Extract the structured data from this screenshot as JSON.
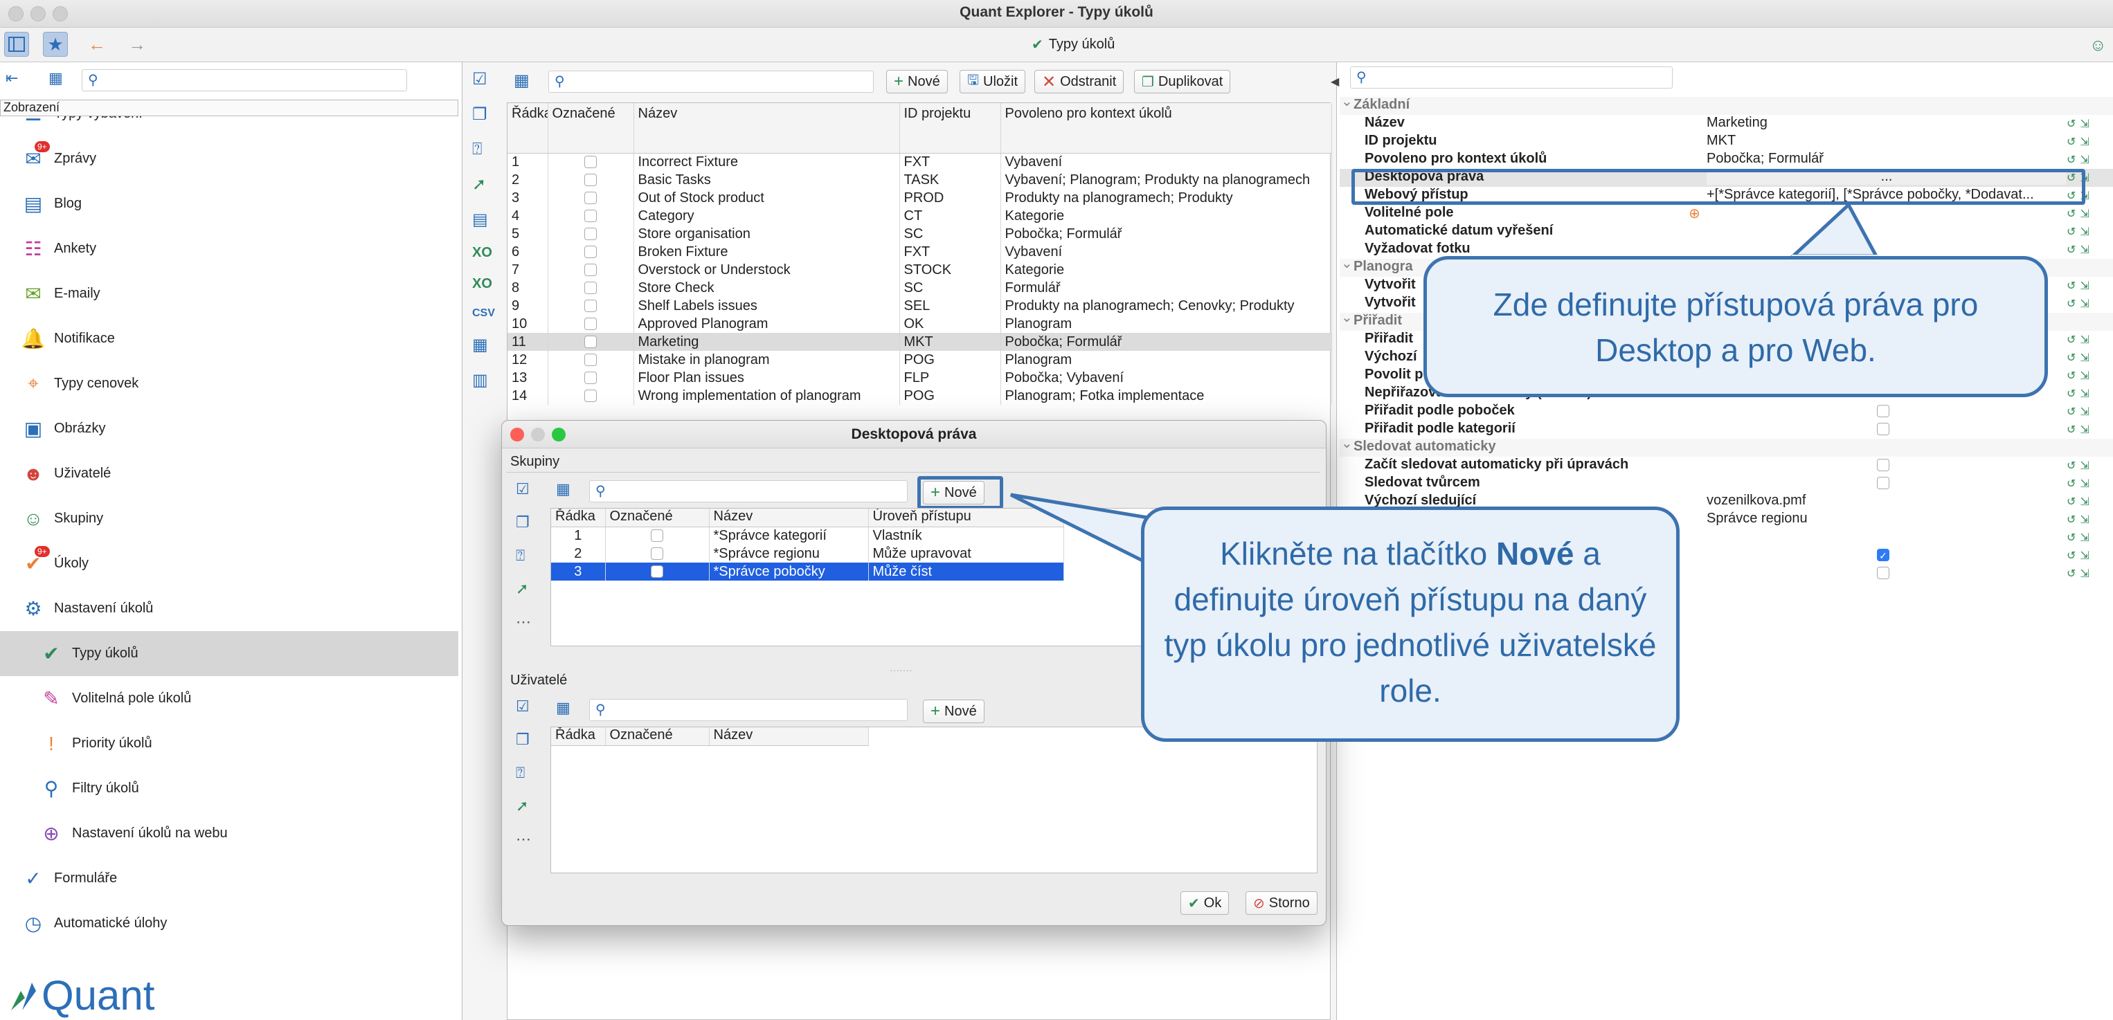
{
  "window": {
    "title": "Quant Explorer - Typy úkolů",
    "center_title": "Typy úkolů"
  },
  "left": {
    "section_label": "Zobrazení",
    "items": [
      {
        "label": "Typy vybavení",
        "icon": "list-icon",
        "color": "#2c6fb7"
      },
      {
        "label": "Zprávy",
        "icon": "messages-icon",
        "badge": "9+",
        "color": "#2c6fb7"
      },
      {
        "label": "Blog",
        "icon": "blog-icon",
        "color": "#2c6fb7"
      },
      {
        "label": "Ankety",
        "icon": "survey-icon",
        "color": "#c23c9b"
      },
      {
        "label": "E-maily",
        "icon": "mail-icon",
        "color": "#6aa32a"
      },
      {
        "label": "Notifikace",
        "icon": "bell-icon",
        "color": "#2c6fb7"
      },
      {
        "label": "Typy cenovek",
        "icon": "price-tag-icon",
        "color": "#e9833a"
      },
      {
        "label": "Obrázky",
        "icon": "image-icon",
        "color": "#2c6fb7"
      },
      {
        "label": "Uživatelé",
        "icon": "user-icon",
        "color": "#d2453c"
      },
      {
        "label": "Skupiny",
        "icon": "group-icon",
        "color": "#2e8b57"
      },
      {
        "label": "Úkoly",
        "icon": "task-icon",
        "badge": "9+",
        "color": "#e9833a"
      },
      {
        "label": "Nastavení úkolů",
        "icon": "task-settings-icon",
        "color": "#2c6fb7"
      },
      {
        "label": "Typy úkolů",
        "icon": "task-type-icon",
        "color": "#2e8b57",
        "selected": true,
        "indent": true
      },
      {
        "label": "Volitelná pole úkolů",
        "icon": "optional-fields-icon",
        "color": "#c23c9b",
        "indent": true
      },
      {
        "label": "Priority úkolů",
        "icon": "priority-icon",
        "color": "#e9833a",
        "indent": true
      },
      {
        "label": "Filtry úkolů",
        "icon": "filter-icon",
        "color": "#2c6fb7",
        "indent": true
      },
      {
        "label": "Nastavení úkolů na webu",
        "icon": "web-settings-icon",
        "color": "#8a4bb5",
        "indent": true
      },
      {
        "label": "Formuláře",
        "icon": "form-icon",
        "color": "#2c6fb7"
      },
      {
        "label": "Automatické úlohy",
        "icon": "clock-icon",
        "color": "#2c6fb7"
      }
    ],
    "logo": "Quant"
  },
  "middle": {
    "buttons": {
      "new": "Nové",
      "save": "Uložit",
      "delete": "Odstranit",
      "duplicate": "Duplikovat"
    },
    "columns": [
      "Řádka",
      "Označené",
      "Název",
      "ID projektu",
      "Povoleno pro kontext úkolů"
    ],
    "rows": [
      [
        "1",
        "Incorrect Fixture",
        "FXT",
        "Vybavení"
      ],
      [
        "2",
        "Basic Tasks",
        "TASK",
        "Vybavení; Planogram; Produkty na planogramech"
      ],
      [
        "3",
        "Out of Stock product",
        "PROD",
        "Produkty na planogramech; Produkty"
      ],
      [
        "4",
        "Category",
        "CT",
        "Kategorie"
      ],
      [
        "5",
        "Store organisation",
        "SC",
        "Pobočka; Formulář"
      ],
      [
        "6",
        "Broken Fixture",
        "FXT",
        "Vybavení"
      ],
      [
        "7",
        "Overstock or Understock",
        "STOCK",
        "Kategorie"
      ],
      [
        "8",
        "Store Check",
        "SC",
        "Formulář"
      ],
      [
        "9",
        "Shelf Labels issues",
        "SEL",
        "Produkty na planogramech; Cenovky; Produkty"
      ],
      [
        "10",
        "Approved Planogram",
        "OK",
        "Planogram"
      ],
      [
        "11",
        "Marketing",
        "MKT",
        "Pobočka; Formulář"
      ],
      [
        "12",
        "Mistake in planogram",
        "POG",
        "Planogram"
      ],
      [
        "13",
        "Floor Plan issues",
        "FLP",
        "Pobočka; Vybavení"
      ],
      [
        "14",
        "Wrong implementation of planogram",
        "POG",
        "Planogram; Fotka implementace"
      ]
    ],
    "selected_row": "11"
  },
  "props": {
    "rows": [
      {
        "k": "Základní",
        "section": true
      },
      {
        "k": "Název",
        "v": "Marketing"
      },
      {
        "k": "ID projektu",
        "v": "MKT"
      },
      {
        "k": "Povoleno pro kontext úkolů",
        "v": "Pobočka; Formulář"
      },
      {
        "k": "Desktopová práva",
        "v": "..."
      },
      {
        "k": "Webový přístup",
        "v": "+[*Správce kategorií], [*Správce pobočky, *Dodavat..."
      },
      {
        "k": "Volitelné pole",
        "v": ""
      },
      {
        "k": "Automatické datum vyřešení",
        "v": ""
      },
      {
        "k": "Vyžadovat fotku",
        "v": ""
      },
      {
        "k": "Planogra",
        "section": true
      },
      {
        "k": "Vytvořit",
        "v": ""
      },
      {
        "k": "Vytvořit",
        "v": ""
      },
      {
        "k": "Přiřadit",
        "section": true
      },
      {
        "k": "Přiřadit",
        "v": ""
      },
      {
        "k": "Výchozí",
        "v": ""
      },
      {
        "k": "Povolit p",
        "v": ""
      },
      {
        "k": "Nepřiřazovat automaticky (Tvůrce)",
        "v": ""
      },
      {
        "k": "Přiřadit podle poboček",
        "v": "",
        "check": "off"
      },
      {
        "k": "Přiřadit podle kategorií",
        "v": "",
        "check": "off"
      },
      {
        "k": "Sledovat automaticky",
        "section": true
      },
      {
        "k": "Začít sledovat automaticky při úpravách",
        "v": "",
        "check": "off"
      },
      {
        "k": "Sledovat tvůrcem",
        "v": "",
        "check": "off"
      },
      {
        "k": "Výchozí sledující",
        "v": "vozenilkova.pmf"
      },
      {
        "k": "",
        "v": "Správce regionu"
      },
      {
        "k": "",
        "v": ""
      },
      {
        "k": "",
        "v": "",
        "check": "on"
      },
      {
        "k": "",
        "v": "",
        "check": "off"
      }
    ]
  },
  "dialog": {
    "title": "Desktopová práva",
    "groups_label": "Skupiny",
    "new": "Nové",
    "columns": [
      "Řádka",
      "Označené",
      "Název",
      "Úroveň přístupu"
    ],
    "rows": [
      [
        "1",
        "*Správce kategorií",
        "Vlastník"
      ],
      [
        "2",
        "*Správce regionu",
        "Může upravovat"
      ],
      [
        "3",
        "*Správce pobočky",
        "Může číst"
      ]
    ],
    "users_label": "Uživatelé",
    "user_columns": [
      "Řádka",
      "Označené",
      "Název"
    ],
    "ok": "Ok",
    "cancel": "Storno"
  },
  "callouts": {
    "top": "Zde definujte přístupová práva pro Desktop a pro Web.",
    "bottom_pre": "Klikněte na tlačítko ",
    "bottom_bold": "Nové",
    "bottom_post": " a definujte úroveň přístupu na daný typ úkolu pro jednotlivé uživatelské role."
  },
  "colors": {
    "accent": "#3d73b0",
    "selection": "#1f5fe0"
  }
}
